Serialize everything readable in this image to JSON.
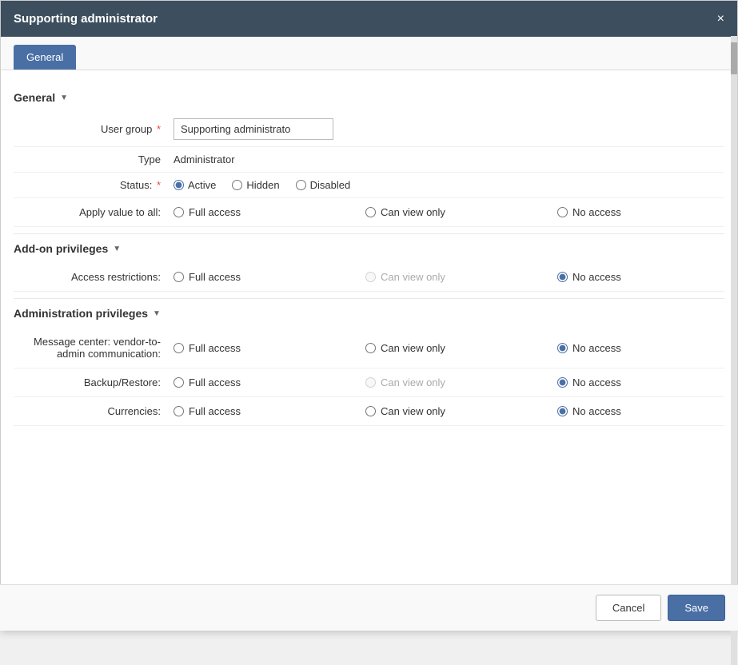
{
  "modal": {
    "title": "Supporting administrator",
    "close_label": "×"
  },
  "tabs": [
    {
      "label": "General",
      "active": true
    }
  ],
  "general_section": {
    "label": "General",
    "fields": {
      "user_group": {
        "label": "User group",
        "required": true,
        "value": "Supporting administrato"
      },
      "type": {
        "label": "Type",
        "value": "Administrator"
      },
      "status": {
        "label": "Status:",
        "required": true,
        "options": [
          "Active",
          "Hidden",
          "Disabled"
        ],
        "selected": "Active"
      }
    }
  },
  "apply_value": {
    "label": "Apply value to all:",
    "options": [
      "Full access",
      "Can view only",
      "No access"
    ]
  },
  "addon_privileges": {
    "label": "Add-on privileges",
    "rows": [
      {
        "label": "Access restrictions:",
        "full_access": {
          "enabled": true,
          "selected": false
        },
        "can_view": {
          "enabled": false,
          "selected": false
        },
        "no_access": {
          "enabled": true,
          "selected": true
        }
      }
    ]
  },
  "administration_privileges": {
    "label": "Administration privileges",
    "rows": [
      {
        "label": "Message center: vendor-to-admin communication:",
        "full_access": {
          "enabled": true,
          "selected": false
        },
        "can_view": {
          "enabled": true,
          "selected": false
        },
        "no_access": {
          "enabled": true,
          "selected": true
        }
      },
      {
        "label": "Backup/Restore:",
        "full_access": {
          "enabled": true,
          "selected": false
        },
        "can_view": {
          "enabled": false,
          "selected": false
        },
        "no_access": {
          "enabled": true,
          "selected": true
        }
      },
      {
        "label": "Currencies:",
        "full_access": {
          "enabled": true,
          "selected": false
        },
        "can_view": {
          "enabled": true,
          "selected": false
        },
        "no_access": {
          "enabled": true,
          "selected": true
        }
      }
    ]
  },
  "footer": {
    "cancel_label": "Cancel",
    "save_label": "Save"
  }
}
